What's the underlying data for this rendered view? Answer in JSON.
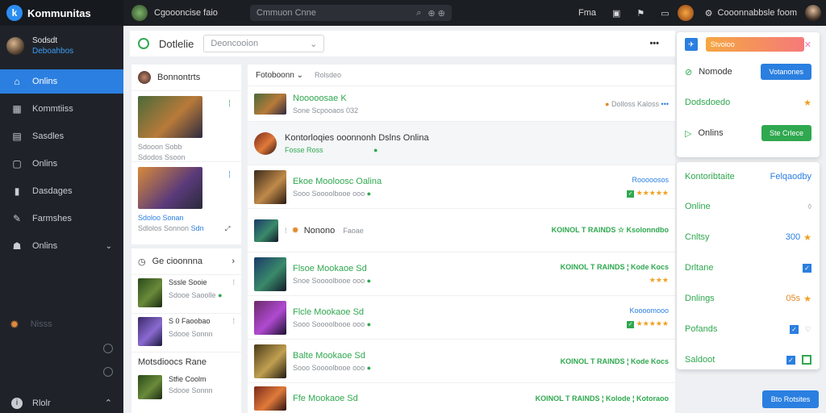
{
  "app": {
    "title": "Kommunitas"
  },
  "profile": {
    "name": "Sodsdt",
    "subtitle": "Deboahbos"
  },
  "nav": [
    {
      "label": "Onlins",
      "icon": "home-icon",
      "active": true
    },
    {
      "label": "Kommtiiss",
      "icon": "grid-icon",
      "active": false
    },
    {
      "label": "Sasdles",
      "icon": "layout-icon",
      "active": false
    },
    {
      "label": "Onlins",
      "icon": "monitor-icon",
      "active": false
    },
    {
      "label": "Dasdages",
      "icon": "bookmark-icon",
      "active": false
    },
    {
      "label": "Farmshes",
      "icon": "pin-icon",
      "active": false
    },
    {
      "label": "Onlins",
      "icon": "user-icon",
      "active": false
    }
  ],
  "side_extra": {
    "label": "Nisss"
  },
  "side_bottom": {
    "label": "Rlolr"
  },
  "topbar": {
    "game_name": "Cgoooncise faio",
    "search_text": "Cmmuon   Cnne",
    "search_hint": "⊕ ⊕",
    "r1": "Fma",
    "r2": "Cooonnabbsle foom"
  },
  "header": {
    "title": "Dotlelie",
    "dropdown": "Deoncooion",
    "more": "•••"
  },
  "left": {
    "head_title": "Bonnontrts",
    "card1": {
      "l1": "Sdooon Sobb",
      "l2": "Sdodos Ssoon"
    },
    "card2": {
      "l1": "Sdoloo Sonan",
      "l2": "Sdlolos Sonnon",
      "price": "Sdn"
    },
    "section2_title": "Ge cioonnna",
    "g1": {
      "l1": "Sssle Sooie",
      "l2": "Sdooe Saoolle"
    },
    "g2": {
      "l1": "S 0 Faoobao",
      "l2": "Sdooe Sonnn"
    },
    "section3_title": "Motsdioocs Rane",
    "g3": {
      "l1": "Stfie Coolm",
      "l2": "Sdooe Sonnn"
    }
  },
  "list": {
    "sort_label": "Fotoboonn",
    "filter_label": "Rolsdeo",
    "rows": [
      {
        "title": "Nooooosae K",
        "meta": "Sone Scpooaos 032",
        "right": "Dolloss Kaloss"
      },
      {
        "title": "Kontorloqies ooonnonh Dslns Onlina",
        "meta": "Fosse Ross"
      },
      {
        "title": "Ekoe Mooloosc Oalina",
        "meta": "Sooo Soooolbooe ooo",
        "right": "Rooooosos"
      },
      {
        "title": "Nonono",
        "meta": "Faoae",
        "right": "KOINOL T RAINDS ☆ Ksolonndbo"
      },
      {
        "title": "Flsoe Mookaoe Sd",
        "meta": "Snoe Soooolbooe ooo",
        "right": "KOINOL T RAINDS ¦ Kode Kocs"
      },
      {
        "title": "Flcle Mookaoe Sd",
        "meta": "Sooo Soooolbooe ooo",
        "right": "Koooomooo"
      },
      {
        "title": "Balte Mookaoe Sd",
        "meta": "Sooo Soooolbooe ooo",
        "right": "KOINOL T RAINDS ¦ Kode Kocs"
      },
      {
        "title": "Ffe Mookaoe Sd",
        "meta": "",
        "right": "KOINOL T RAINDS ¦ Kolode ¦ Kotoraoo"
      }
    ]
  },
  "right_panel": {
    "tag": "Stvoioo",
    "r1": "Nomode",
    "r1_btn": "Votanones",
    "r2": "Dodsdoedo",
    "r3": "Onlins",
    "r3_btn": "Ste Crlece",
    "h1": "Kontoribtaite",
    "h2": "Felqaodby",
    "i1": "Online",
    "i2": "Cnltsy",
    "i2_val": "300",
    "i3": "Drltane",
    "i4": "Dnlings",
    "i4_val": "05s",
    "i5": "Pofands",
    "i6": "Saldoot",
    "bottom_btn": "Bto Rotsites"
  },
  "colors": {
    "accent": "#2b7fe0",
    "success": "#2fa84f",
    "warning": "#f0a020",
    "sidebar": "#1f2329"
  }
}
